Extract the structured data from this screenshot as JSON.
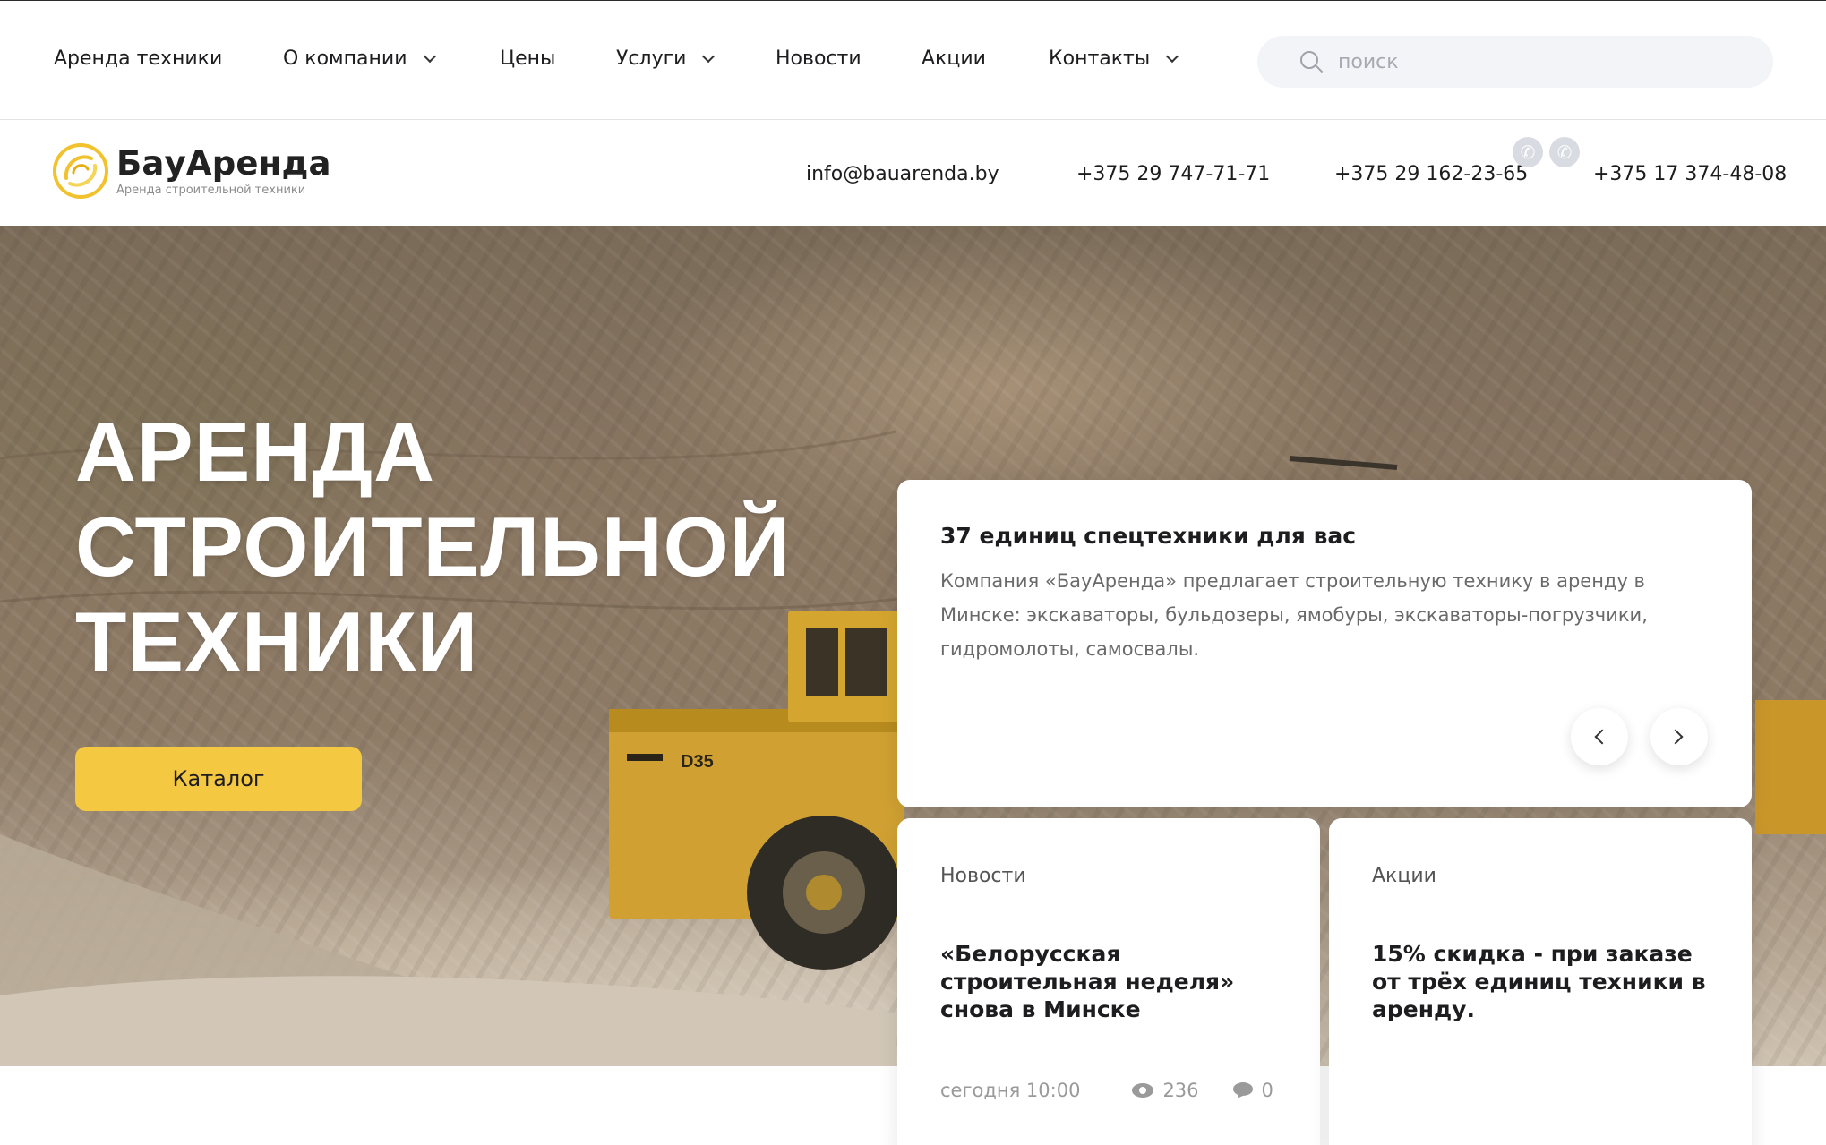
{
  "nav": {
    "items": [
      {
        "label": "Аренда техники",
        "dropdown": false
      },
      {
        "label": "О компании",
        "dropdown": true
      },
      {
        "label": "Цены",
        "dropdown": false
      },
      {
        "label": "Услуги",
        "dropdown": true
      },
      {
        "label": "Новости",
        "dropdown": false
      },
      {
        "label": "Акции",
        "dropdown": false
      },
      {
        "label": "Контакты",
        "dropdown": true
      }
    ],
    "search_placeholder": "поиск"
  },
  "header": {
    "logo_name": "БауАренда",
    "logo_tagline": "Аренда строительной техники",
    "email": "info@bauarenda.by",
    "phones": [
      "+375 29 747-71-71",
      "+375 29 162-23-65",
      "+375 17 374-48-08"
    ],
    "messenger_icons": [
      "whatsapp-icon",
      "viber-icon"
    ]
  },
  "hero": {
    "title_lines": [
      "АРЕНДА",
      "СТРОИТЕЛЬНОЙ",
      "ТЕХНИКИ"
    ],
    "catalog_button": "Каталог",
    "truck_marking": "D35"
  },
  "info_card": {
    "title": "37 единиц спецтехники для вас",
    "description": "Компания «БауАренда» предлагает строительную технику в аренду в Минске: экскаваторы, бульдозеры, ямобуры, экскаваторы-погрузчики, гидромолоты, самосвалы."
  },
  "news_card": {
    "label": "Новости",
    "title": "«Белорусская строительная неделя» снова в Минске",
    "time": "сегодня 10:00",
    "views": "236",
    "comments": "0"
  },
  "promo_card": {
    "label": "Акции",
    "title": "15% скидка - при заказе от трёх единиц техники в аренду."
  },
  "colors": {
    "accent_yellow": "#f5c842",
    "text_dark": "#1d1d1f",
    "search_bg": "#f3f4f7"
  }
}
